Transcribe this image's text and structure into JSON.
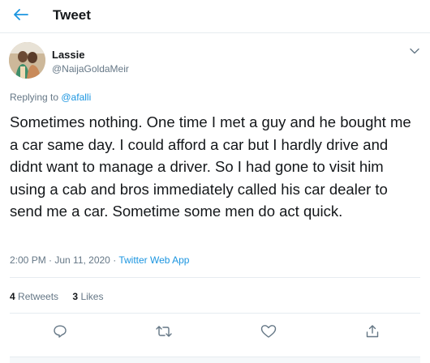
{
  "header": {
    "title": "Tweet",
    "back_icon": "arrow-left-icon"
  },
  "colors": {
    "accent": "#1b95e0",
    "text": "#14171a",
    "muted": "#657786",
    "border": "#e6ecf0"
  },
  "author": {
    "display_name": "Lassie",
    "handle": "@NaijaGoldaMeir"
  },
  "reply": {
    "prefix": "Replying to ",
    "mention": "@afalli"
  },
  "tweet": {
    "text": "Sometimes nothing. One time I met a guy and he bought me a car same day. I could afford a car but I hardly drive and didnt want to manage a driver. So I had gone to visit him using a cab and bros immediately called his car dealer to send me a car. Sometime some men do act quick.",
    "timestamp": "2:00 PM · Jun 11, 2020 · ",
    "source": "Twitter Web App"
  },
  "stats": {
    "retweets_count": "4",
    "retweets_label": "Retweets",
    "likes_count": "3",
    "likes_label": "Likes"
  },
  "actions": [
    "reply-icon",
    "retweet-icon",
    "like-icon",
    "share-icon"
  ]
}
